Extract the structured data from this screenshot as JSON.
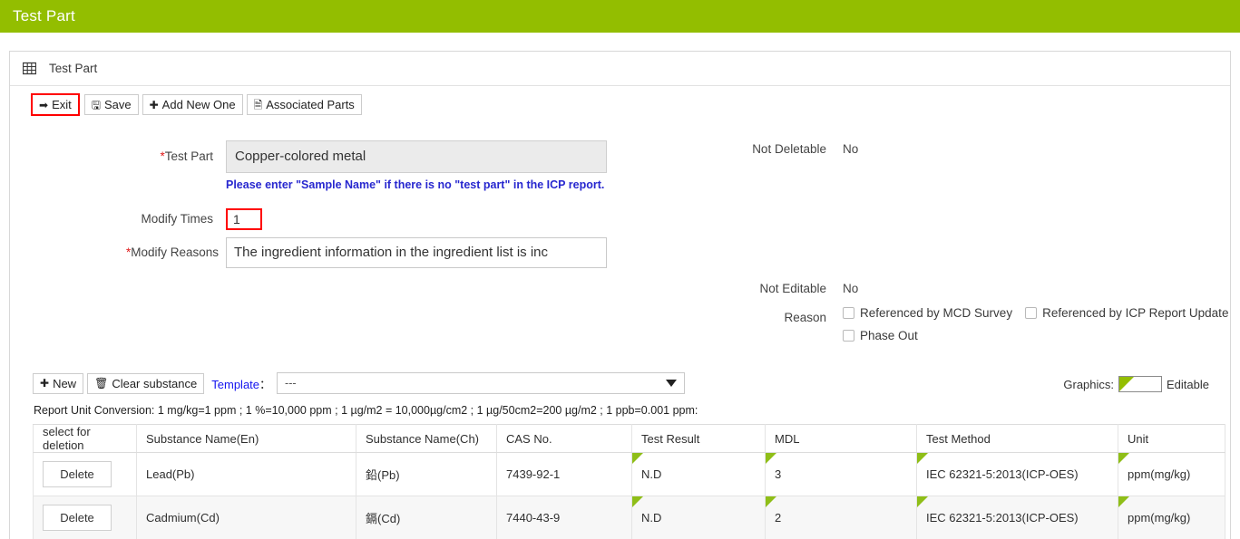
{
  "app": {
    "banner_title": "Test Part",
    "accent_green": "#93be00",
    "highlight_red": "#ff0000",
    "link_blue": "#1414ef"
  },
  "card": {
    "header_label": "Test Part",
    "header_icon": "grid-icon"
  },
  "toolbar": {
    "exit_label": "Exit",
    "save_label": "Save",
    "add_new_one_label": "Add New One",
    "associated_parts_label": "Associated Parts",
    "exit_icon": "exit-arrow-icon",
    "save_icon": "floppy-disk-icon",
    "add_icon": "plus-icon",
    "associated_icon": "document-icon"
  },
  "form": {
    "test_part_label": "Test Part",
    "test_part_required": "*",
    "test_part_value": "Copper-colored metal",
    "test_part_hint": "Please enter \"Sample Name\" if there is no \"test part\" in the ICP report.",
    "modify_times_label": "Modify Times",
    "modify_times_value": "1",
    "modify_reasons_label": "Modify Reasons",
    "modify_reasons_required": "*",
    "modify_reasons_value": "The ingredient information in the ingredient list is inc",
    "not_deletable_label": "Not Deletable",
    "not_deletable_value": "No",
    "not_editable_label": "Not Editable",
    "not_editable_value": "No",
    "reason_label": "Reason",
    "reason_options": [
      {
        "label": "Referenced by MCD Survey",
        "checked": false
      },
      {
        "label": "Referenced by ICP Report Update",
        "checked": false
      },
      {
        "label": "Phase Out",
        "checked": false
      }
    ]
  },
  "substance_toolbar": {
    "new_label": "New",
    "new_icon": "plus-icon",
    "clear_substance_label": "Clear substance",
    "clear_icon": "trash-icon",
    "template_label": "Template",
    "template_colon": "：",
    "template_selected": "---",
    "graphics_label": "Graphics:",
    "editable_label": "Editable",
    "unit_conversion_note": "Report Unit Conversion: 1 mg/kg=1 ppm ; 1 %=10,000 ppm ; 1 µg/m2 = 10,000µg/cm2 ; 1 µg/50cm2=200 µg/m2 ; 1 ppb=0.001 ppm:"
  },
  "table": {
    "columns": [
      "select for deletion",
      "Substance Name(En)",
      "Substance Name(Ch)",
      "CAS No.",
      "Test Result",
      "MDL",
      "Test Method",
      "Unit"
    ],
    "delete_button_label": "Delete",
    "rows": [
      {
        "name_en": "Lead(Pb)",
        "name_ch": "鉛(Pb)",
        "cas_no": "7439-92-1",
        "test_result": "N.D",
        "mdl": "3",
        "test_method": "IEC 62321-5:2013(ICP-OES)",
        "unit": "ppm(mg/kg)"
      },
      {
        "name_en": "Cadmium(Cd)",
        "name_ch": "鎘(Cd)",
        "cas_no": "7440-43-9",
        "test_result": "N.D",
        "mdl": "2",
        "test_method": "IEC 62321-5:2013(ICP-OES)",
        "unit": "ppm(mg/kg)"
      }
    ]
  }
}
